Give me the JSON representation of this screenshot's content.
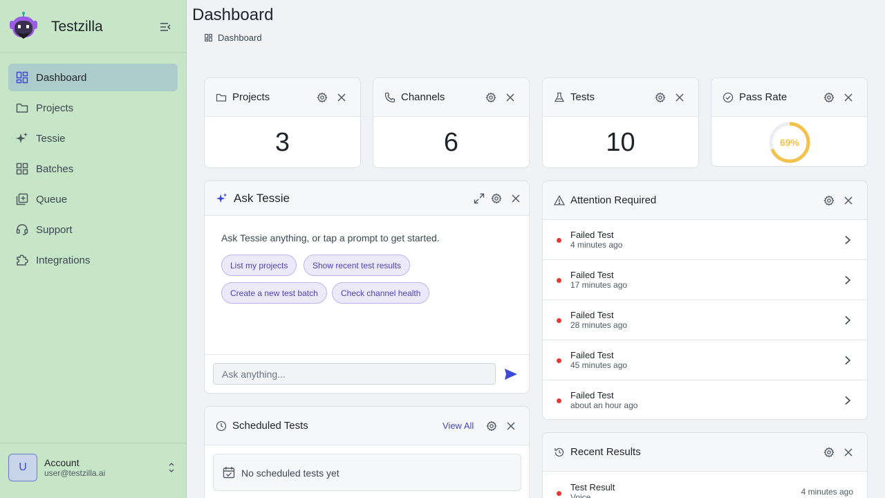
{
  "app": {
    "name": "Testzilla"
  },
  "sidebar": {
    "items": [
      {
        "label": "Dashboard",
        "icon": "dashboard-icon",
        "active": true
      },
      {
        "label": "Projects",
        "icon": "folder-icon"
      },
      {
        "label": "Tessie",
        "icon": "sparkle-icon"
      },
      {
        "label": "Batches",
        "icon": "grid-icon"
      },
      {
        "label": "Queue",
        "icon": "queue-icon"
      },
      {
        "label": "Support",
        "icon": "headset-icon"
      },
      {
        "label": "Integrations",
        "icon": "puzzle-icon"
      }
    ],
    "account": {
      "initial": "U",
      "name": "Account",
      "email": "user@testzilla.ai"
    }
  },
  "header": {
    "title": "Dashboard",
    "breadcrumb": "Dashboard"
  },
  "stats": [
    {
      "title": "Projects",
      "value": "3",
      "icon": "folder-icon"
    },
    {
      "title": "Channels",
      "value": "6",
      "icon": "phone-icon"
    },
    {
      "title": "Tests",
      "value": "10",
      "icon": "flask-icon"
    },
    {
      "title": "Pass Rate",
      "value": "69%",
      "percent": 69,
      "icon": "check-circle-icon"
    }
  ],
  "ask": {
    "title": "Ask Tessie",
    "intro": "Ask Tessie anything, or tap a prompt to get started.",
    "prompts": [
      "List my projects",
      "Show recent test results",
      "Create a new test batch",
      "Check channel health"
    ],
    "placeholder": "Ask anything..."
  },
  "attention": {
    "title": "Attention Required",
    "items": [
      {
        "title": "Failed Test",
        "time": "4 minutes ago"
      },
      {
        "title": "Failed Test",
        "time": "17 minutes ago"
      },
      {
        "title": "Failed Test",
        "time": "28 minutes ago"
      },
      {
        "title": "Failed Test",
        "time": "45 minutes ago"
      },
      {
        "title": "Failed Test",
        "time": "about an hour ago"
      }
    ]
  },
  "scheduled": {
    "title": "Scheduled Tests",
    "view_all": "View All",
    "empty": "No scheduled tests yet"
  },
  "recent": {
    "title": "Recent Results",
    "items": [
      {
        "title": "Test Result",
        "subtitle": "Voice",
        "time": "4 minutes ago"
      }
    ]
  },
  "colors": {
    "accent": "#3b4bd6",
    "sidebar": "#c7e5c7",
    "active": "#adcccc",
    "warning": "#f2c14e",
    "error": "#e53935"
  }
}
